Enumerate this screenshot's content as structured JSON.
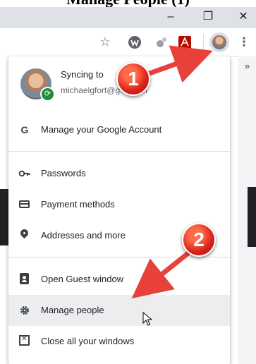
{
  "caption": {
    "text": "Manage People (1)"
  },
  "window": {
    "minimize_label": "–",
    "restore_label": "❐",
    "close_label": "✕"
  },
  "toolbar": {
    "icons": [
      "star-icon",
      "extension-w-icon",
      "extension-puzzle-icon",
      "adobe-pdf-icon",
      "profile-avatar-button"
    ],
    "overflow_label": "»"
  },
  "profile": {
    "sync_title": "Syncing to",
    "email": "michaelgfort@g...l.com"
  },
  "menu": {
    "manage_account": "Manage your Google Account",
    "passwords": "Passwords",
    "payment_methods": "Payment methods",
    "addresses": "Addresses and more",
    "guest_window": "Open Guest window",
    "manage_people": "Manage people",
    "close_windows": "Close all your windows"
  },
  "annotations": {
    "step1": "1",
    "step2": "2"
  },
  "colors": {
    "arrow": "#e8403a",
    "hover_row": "#ebedef",
    "sync_badge": "#1e8e3e"
  }
}
